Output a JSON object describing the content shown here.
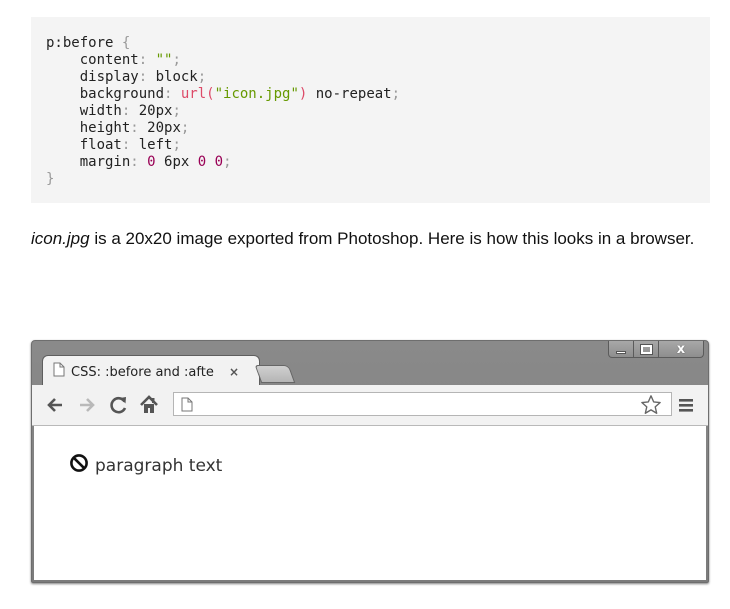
{
  "code": {
    "selector": "p:before",
    "open_brace": "{",
    "close_brace": "}",
    "lines": [
      {
        "prop": "content",
        "value": "\"\"",
        "kind": "str-plain"
      },
      {
        "prop": "display",
        "value": "block",
        "kind": "plain"
      },
      {
        "prop": "background",
        "url_fn": "url(",
        "url_str": "\"icon.jpg\"",
        "url_close": ")",
        "rest": " no-repeat",
        "kind": "url"
      },
      {
        "prop": "width",
        "value": "20px",
        "kind": "plain"
      },
      {
        "prop": "height",
        "value": "20px",
        "kind": "plain"
      },
      {
        "prop": "float",
        "value": "left",
        "kind": "plain"
      },
      {
        "prop": "margin",
        "kind": "margin",
        "v1": "0",
        "v2": "6px",
        "v3": "0",
        "v4": "0"
      }
    ]
  },
  "paragraph": {
    "italic": "icon.jpg",
    "text": " is a 20x20 image exported from Photoshop. Here is how this looks in a browser."
  },
  "browser": {
    "tab_title": "CSS: :before and :afte",
    "tab_close": "×",
    "page_text": "paragraph text",
    "window_close": "x"
  }
}
